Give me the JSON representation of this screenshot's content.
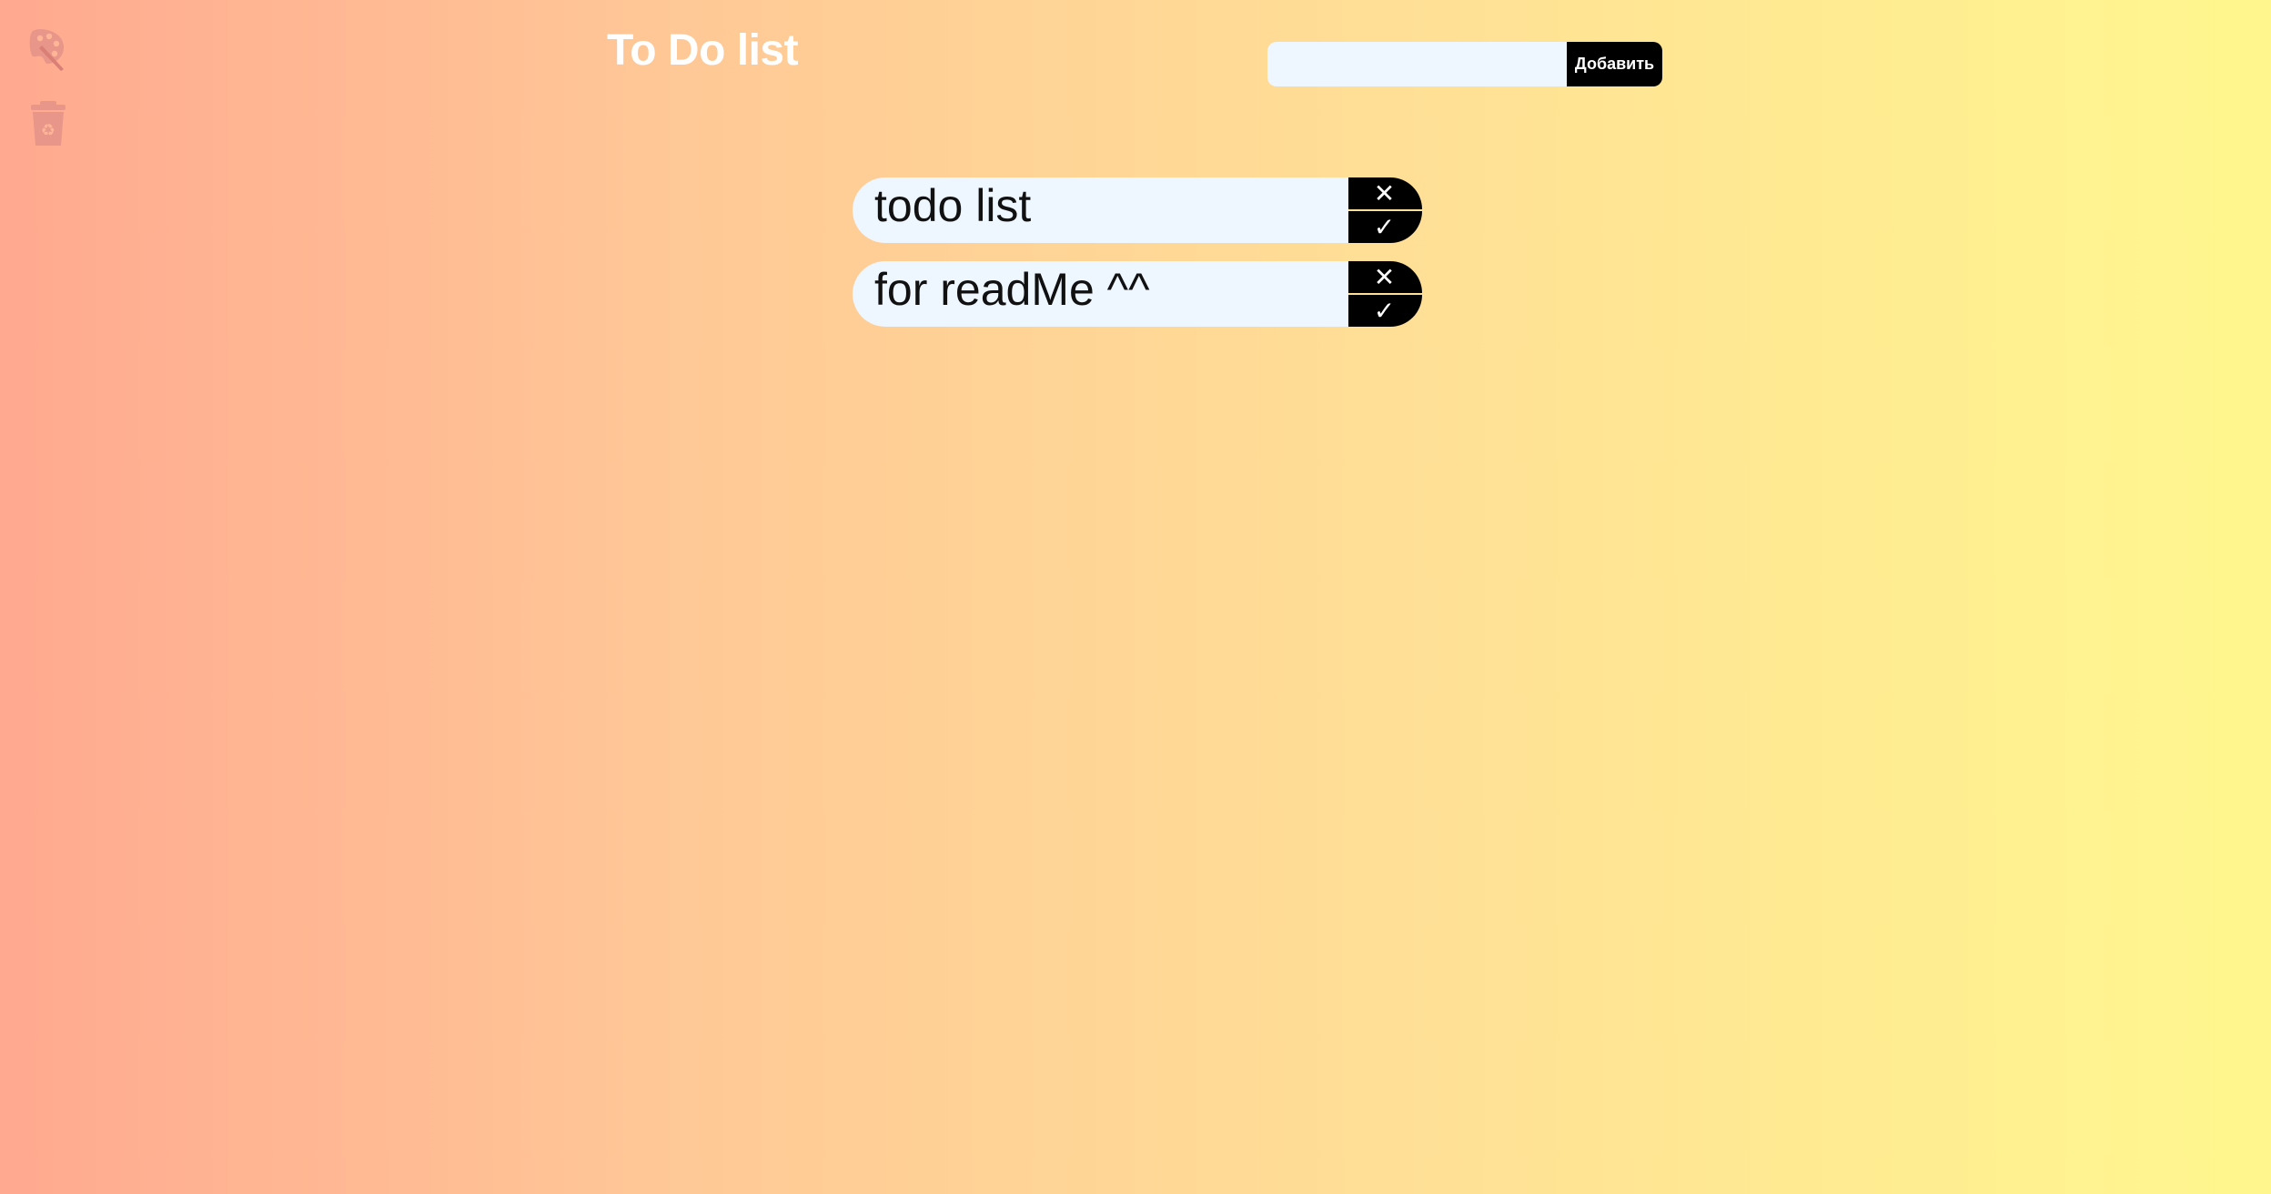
{
  "app": {
    "title": "To Do list"
  },
  "sidebar": {
    "palette_icon": "palette-icon",
    "bin_icon": "recycle-bin-icon"
  },
  "add_form": {
    "input_value": "",
    "input_placeholder": "",
    "button_label": "Добавить"
  },
  "todos": [
    {
      "text": "todo list",
      "delete_glyph": "✕",
      "done_glyph": "✓"
    },
    {
      "text": "for readMe ^^",
      "delete_glyph": "✕",
      "done_glyph": "✓"
    }
  ],
  "colors": {
    "gradient_start": "#ffa990",
    "gradient_end": "#fff78e",
    "item_background": "#eef6ff",
    "button_background": "#000000",
    "icon_color": "#e8968a"
  }
}
